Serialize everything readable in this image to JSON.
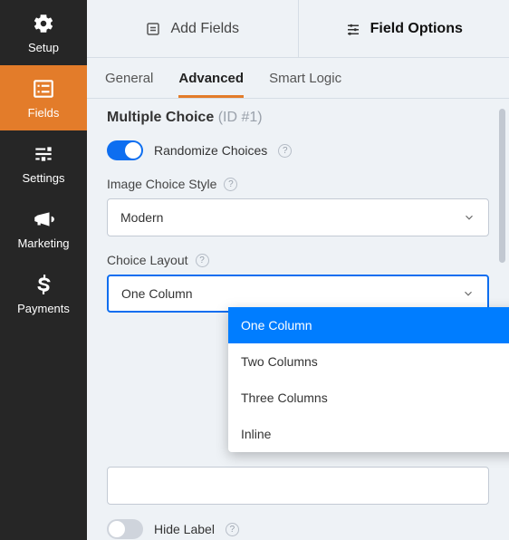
{
  "sidebar": {
    "items": [
      {
        "label": "Setup"
      },
      {
        "label": "Fields"
      },
      {
        "label": "Settings"
      },
      {
        "label": "Marketing"
      },
      {
        "label": "Payments"
      }
    ],
    "activeIndex": 1
  },
  "topTabs": {
    "addFields": "Add Fields",
    "fieldOptions": "Field Options",
    "active": "fieldOptions"
  },
  "subTabs": {
    "general": "General",
    "advanced": "Advanced",
    "smartLogic": "Smart Logic",
    "active": "advanced"
  },
  "field": {
    "title": "Multiple Choice",
    "idLabel": "(ID #1)"
  },
  "randomize": {
    "label": "Randomize Choices",
    "enabled": true
  },
  "imageChoiceStyle": {
    "label": "Image Choice Style",
    "value": "Modern"
  },
  "choiceLayout": {
    "label": "Choice Layout",
    "value": "One Column",
    "options": [
      "One Column",
      "Two Columns",
      "Three Columns",
      "Inline"
    ]
  },
  "hideLabel": {
    "label": "Hide Label",
    "enabled": false
  }
}
